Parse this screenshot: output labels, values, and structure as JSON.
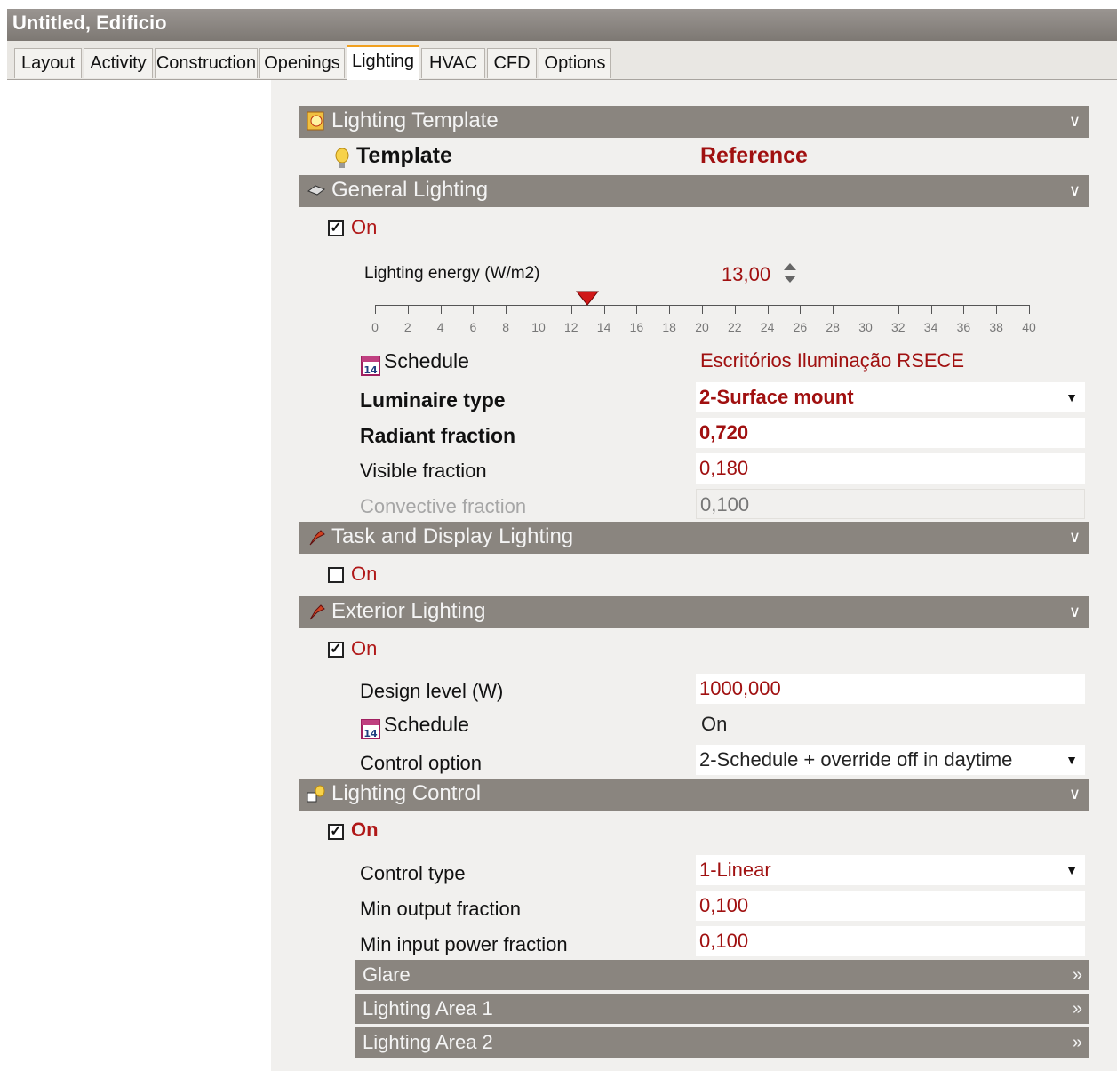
{
  "window": {
    "title": "Untitled, Edificio"
  },
  "tabs": [
    "Layout",
    "Activity",
    "Construction",
    "Openings",
    "Lighting",
    "HVAC",
    "CFD",
    "Options"
  ],
  "active_tab": "Lighting",
  "sections": {
    "template": {
      "header": "Lighting Template",
      "label": "Template",
      "value": "Reference"
    },
    "general": {
      "header": "General Lighting",
      "on_label": "On",
      "on_checked": true,
      "energy_label": "Lighting energy (W/m2)",
      "energy_value": "13,00",
      "slider_ticks": [
        "0",
        "2",
        "4",
        "6",
        "8",
        "10",
        "12",
        "14",
        "16",
        "18",
        "20",
        "22",
        "24",
        "26",
        "28",
        "30",
        "32",
        "34",
        "36",
        "38",
        "40"
      ],
      "schedule_label": "Schedule",
      "schedule_value": "Escritórios Iluminação RSECE",
      "luminaire_label": "Luminaire type",
      "luminaire_value": "2-Surface mount",
      "radiant_label": "Radiant fraction",
      "radiant_value": "0,720",
      "visible_label": "Visible fraction",
      "visible_value": "0,180",
      "convective_label": "Convective fraction",
      "convective_value": "0,100"
    },
    "task": {
      "header": "Task and Display Lighting",
      "on_label": "On",
      "on_checked": false
    },
    "exterior": {
      "header": "Exterior Lighting",
      "on_label": "On",
      "on_checked": true,
      "design_label": "Design level (W)",
      "design_value": "1000,000",
      "schedule_label": "Schedule",
      "schedule_value": "On",
      "control_label": "Control option",
      "control_value": "2-Schedule + override off in daytime"
    },
    "control": {
      "header": "Lighting Control",
      "on_label": "On",
      "on_checked": true,
      "type_label": "Control type",
      "type_value": "1-Linear",
      "minout_label": "Min output fraction",
      "minout_value": "0,100",
      "minin_label": "Min input power fraction",
      "minin_value": "0,100",
      "subsections": [
        "Glare",
        "Lighting Area 1",
        "Lighting Area 2"
      ]
    }
  },
  "icons": {
    "expand": "double-chevron-down-icon",
    "sub_expand": "double-chevron-right-icon",
    "dropdown": "dropdown-arrow-icon",
    "spinner": "spinner-arrows-icon"
  },
  "colors": {
    "section_bg": "#8a857f",
    "value_red": "#a01010",
    "slider_marker": "#d01818"
  }
}
